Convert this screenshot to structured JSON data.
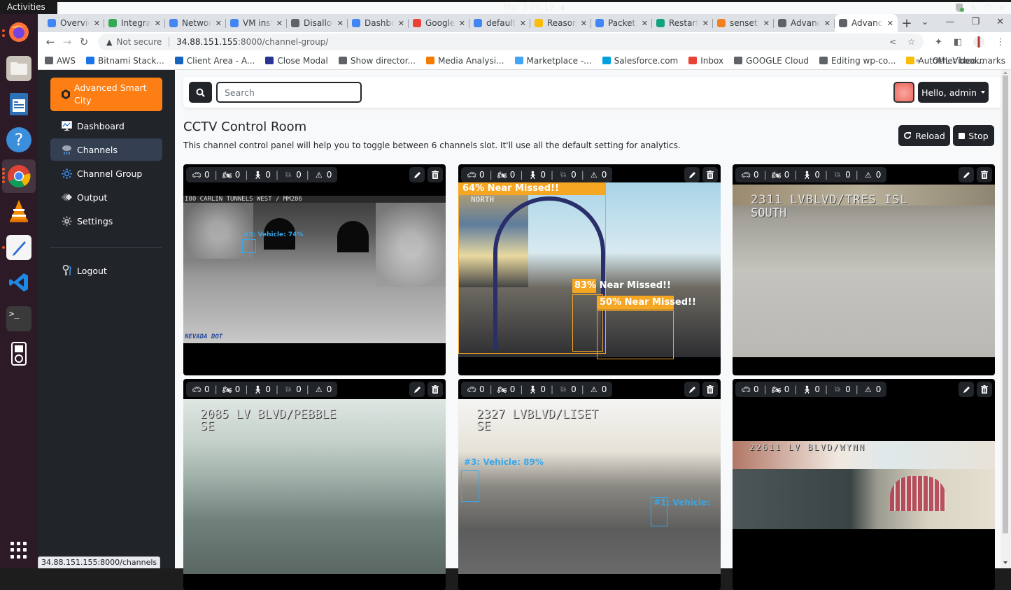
{
  "os": {
    "activities": "Activities",
    "app_name": "Google Chrome",
    "clock": "Mar 3  06:19",
    "dock_apps": [
      "Firefox",
      "Files",
      "LibreOffice Writer",
      "Help",
      "Google Chrome",
      "VLC",
      "Text Editor",
      "Visual Studio Code",
      "Terminal",
      "Rhythmbox"
    ]
  },
  "browser": {
    "tabs": [
      {
        "label": "Overview",
        "color": "#4285f4"
      },
      {
        "label": "Integrations",
        "color": "#34a853"
      },
      {
        "label": "Network",
        "color": "#4285f4"
      },
      {
        "label": "VM instances",
        "color": "#4285f4"
      },
      {
        "label": "Disallow",
        "color": "#5f6368"
      },
      {
        "label": "Dashboard",
        "color": "#4285f4"
      },
      {
        "label": "Google",
        "color": "#ea4335"
      },
      {
        "label": "default",
        "color": "#4285f4"
      },
      {
        "label": "Reason",
        "color": "#fbbc04"
      },
      {
        "label": "Packet",
        "color": "#4285f4"
      },
      {
        "label": "Restart",
        "color": "#10a37f"
      },
      {
        "label": "sensetr",
        "color": "#f38020"
      },
      {
        "label": "Advanced",
        "color": "#5f6368"
      },
      {
        "label": "Advanced",
        "color": "#5f6368",
        "active": true
      }
    ],
    "security_label": "Not secure",
    "url_host": "34.88.151.155",
    "url_path": ":8000/channel-group/",
    "bookmarks": [
      {
        "label": "AWS",
        "color": "#5f6368"
      },
      {
        "label": "Bitnami Stack...",
        "color": "#1a73e8"
      },
      {
        "label": "Client Area - A...",
        "color": "#1565c0"
      },
      {
        "label": "Close Modal",
        "color": "#283593"
      },
      {
        "label": "Show director...",
        "color": "#5f6368"
      },
      {
        "label": "Media Analysi...",
        "color": "#f57c00"
      },
      {
        "label": "Marketplace -...",
        "color": "#42a5f5"
      },
      {
        "label": "Salesforce.com",
        "color": "#00a1e0"
      },
      {
        "label": "Inbox",
        "color": "#ea4335"
      },
      {
        "label": "GOOGLE Cloud",
        "color": "#5f6368"
      },
      {
        "label": "Editing wp-co...",
        "color": "#5f6368"
      },
      {
        "label": "AutoML Video...",
        "color": "#fbbc04"
      }
    ],
    "other_bookmarks": "Other bookmarks",
    "status_url": "34.88.151.155:8000/channels"
  },
  "sidebar": {
    "brand": "Advanced Smart City",
    "brand_color": "#fd7e14",
    "items": [
      {
        "label": "Dashboard",
        "icon": "monitor-chart-icon"
      },
      {
        "label": "Channels",
        "icon": "cloud-rain-icon",
        "active": true
      },
      {
        "label": "Channel Group",
        "icon": "network-icon"
      },
      {
        "label": "Output",
        "icon": "output-icon"
      },
      {
        "label": "Settings",
        "icon": "gear-icon"
      }
    ],
    "logout": "Logout"
  },
  "header": {
    "search_placeholder": "Search",
    "user_label": "Hello, admin"
  },
  "page": {
    "title": "CCTV Control Room",
    "description": "This channel control panel will help you to toggle between 6 channels slot. It'll use all the default setting for analytics.",
    "reload_label": "Reload",
    "stop_label": "Stop"
  },
  "channels": [
    {
      "counts": {
        "car": "0",
        "motorcycle": "0",
        "pedestrian": "0",
        "crash": "0",
        "warning": "0"
      },
      "camera_label": "I80 CARLIN TUNNELS WEST / MM286",
      "watermark": "NEVADA DOT",
      "detections": [
        {
          "label": "#3: Vehicle: 74%",
          "type": "vehicle"
        }
      ]
    },
    {
      "counts": {
        "car": "0",
        "motorcycle": "0",
        "pedestrian": "0",
        "crash": "0",
        "warning": "0"
      },
      "camera_label": "NORTH",
      "detections": [
        {
          "label": "64% Near Missed!!",
          "type": "near-miss"
        },
        {
          "label": "83% Near Missed!!",
          "type": "near-miss"
        },
        {
          "label": "50% Near Missed!!",
          "type": "near-miss"
        }
      ]
    },
    {
      "counts": {
        "car": "0",
        "motorcycle": "0",
        "pedestrian": "0",
        "crash": "0",
        "warning": "0"
      },
      "camera_label": "2311 LVBLVD/TRES ISL",
      "camera_sub": "SOUTH",
      "detections": []
    },
    {
      "counts": {
        "car": "0",
        "motorcycle": "0",
        "pedestrian": "0",
        "crash": "0",
        "warning": "0"
      },
      "camera_label": "2085 LV BLVD/PEBBLE",
      "camera_sub": "SE",
      "detections": []
    },
    {
      "counts": {
        "car": "0",
        "motorcycle": "0",
        "pedestrian": "0",
        "crash": "0",
        "warning": "0"
      },
      "camera_label": "2327 LVBLVD/LISET",
      "camera_sub": "SE",
      "detections": [
        {
          "label": "#3: Vehicle: 89%",
          "type": "vehicle"
        },
        {
          "label": "#1: Vehicle:",
          "type": "vehicle"
        }
      ]
    },
    {
      "counts": {
        "car": "0",
        "motorcycle": "0",
        "pedestrian": "0",
        "crash": "0",
        "warning": "0"
      },
      "camera_label": "22611 LV BLVD/WYNN",
      "detections": []
    }
  ],
  "colors": {
    "vehicle_box": "#3aa7e8",
    "near_miss_box": "#f5a623",
    "dark": "#212529",
    "accent": "#fd7e14"
  }
}
